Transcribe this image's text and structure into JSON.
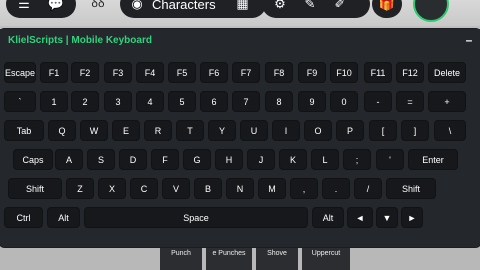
{
  "topbar": {
    "characters_label": "Characters"
  },
  "window": {
    "title": "KlielScripts | Mobile Keyboard",
    "minimize_label": "–"
  },
  "keyboard": {
    "row1": [
      "Escape",
      "F1",
      "F2",
      "F3",
      "F4",
      "F5",
      "F6",
      "F7",
      "F8",
      "F9",
      "F10",
      "F11",
      "F12",
      "Delete"
    ],
    "row2": [
      "`",
      "1",
      "2",
      "3",
      "4",
      "5",
      "6",
      "7",
      "8",
      "9",
      "0",
      "-",
      "=",
      "+"
    ],
    "row3": [
      "Tab",
      "Q",
      "W",
      "E",
      "R",
      "T",
      "Y",
      "U",
      "I",
      "O",
      "P",
      "[",
      "]",
      "\\"
    ],
    "row4": [
      "Caps",
      "A",
      "S",
      "D",
      "F",
      "G",
      "H",
      "J",
      "K",
      "L",
      ";",
      "'",
      "Enter"
    ],
    "row5": [
      "Shift",
      "Z",
      "X",
      "C",
      "V",
      "B",
      "N",
      "M",
      ",",
      ".",
      "/",
      "Shift"
    ],
    "row6": [
      "Ctrl",
      "Alt",
      "Space",
      "Alt",
      "◄",
      "▼",
      "►"
    ]
  },
  "background_buttons": [
    "Punch",
    "e Punches",
    "Shove",
    "Uppercut"
  ]
}
